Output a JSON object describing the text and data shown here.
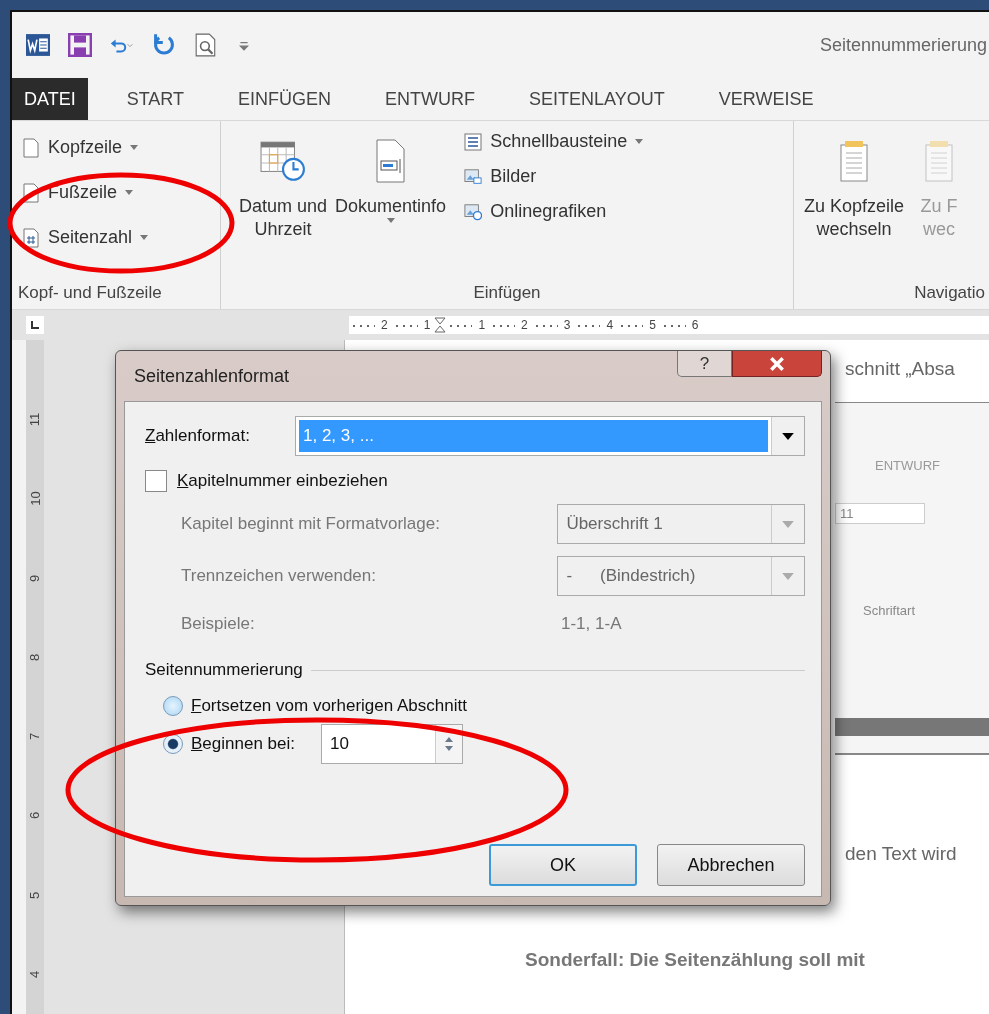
{
  "title_bar": {
    "title": "Seitennummerierung"
  },
  "tabs": [
    {
      "label": "DATEI",
      "selected": true
    },
    {
      "label": "START",
      "selected": false
    },
    {
      "label": "EINFÜGEN",
      "selected": false
    },
    {
      "label": "ENTWURF",
      "selected": false
    },
    {
      "label": "SEITENLAYOUT",
      "selected": false
    },
    {
      "label": "VERWEISE",
      "selected": false
    }
  ],
  "ribbon": {
    "groups": [
      {
        "label": "Kopf- und Fußzeile",
        "items": [
          {
            "kind": "small",
            "label": "Kopfzeile",
            "dropdown": true
          },
          {
            "kind": "small",
            "label": "Fußzeile",
            "dropdown": true
          },
          {
            "kind": "small",
            "label": "Seitenzahl",
            "dropdown": true
          }
        ]
      },
      {
        "label": "Einfügen",
        "items": [
          {
            "kind": "large",
            "lines": [
              "Datum und",
              "Uhrzeit"
            ],
            "dropdown": false
          },
          {
            "kind": "large",
            "lines": [
              "Dokumentinfo"
            ],
            "dropdown": true
          },
          {
            "kind": "small",
            "label": "Schnellbausteine",
            "dropdown": true
          },
          {
            "kind": "small",
            "label": "Bilder",
            "dropdown": false
          },
          {
            "kind": "small",
            "label": "Onlinegrafiken",
            "dropdown": false
          }
        ]
      },
      {
        "label": "Navigatio",
        "items": [
          {
            "kind": "large",
            "lines": [
              "Zu Kopfzeile",
              "wechseln"
            ],
            "disabled": false
          },
          {
            "kind": "large",
            "lines": [
              "Zu F",
              "wec"
            ],
            "disabled": true
          }
        ]
      }
    ]
  },
  "horizontal_ruler": [
    "2",
    "1",
    "1",
    "2",
    "3",
    "4",
    "5",
    "6"
  ],
  "vertical_ruler": [
    "11",
    "10",
    "9",
    "8",
    "7",
    "6",
    "5",
    "4"
  ],
  "document": {
    "lines": [
      {
        "kind": "text",
        "text": "schnitt „Absa"
      },
      {
        "kind": "text",
        "text": "den Text wird"
      },
      {
        "kind": "heading",
        "text": "Sonderfall: Die Seitenzählung soll mit"
      }
    ],
    "embedded_screenshot": {
      "tab": "ENTWURF",
      "font_size": "11",
      "group": "Schriftart"
    }
  },
  "dialog": {
    "title": "Seitenzahlenformat",
    "help": "?",
    "number_format": {
      "label": "Zahlenformat:",
      "value": "1, 2, 3, ..."
    },
    "include_chapter": {
      "label": "Kapitelnummer einbeziehen",
      "checked": false
    },
    "chapter_style": {
      "label": "Kapitel beginnt mit Formatvorlage:",
      "value": "Überschrift 1",
      "disabled": true
    },
    "separator": {
      "label": "Trennzeichen verwenden:",
      "symbol": "-",
      "value": "(Bindestrich)",
      "disabled": true
    },
    "examples": {
      "label": "Beispiele:",
      "value": "1-1, 1-A"
    },
    "section": "Seitennummerierung",
    "options": [
      {
        "label": "Fortsetzen vom vorherigen Abschnitt",
        "selected": false
      },
      {
        "label": "Beginnen bei:",
        "selected": true
      }
    ],
    "start_at": "10",
    "buttons": [
      {
        "label": "OK",
        "default": true
      },
      {
        "label": "Abbrechen",
        "default": false
      }
    ]
  }
}
